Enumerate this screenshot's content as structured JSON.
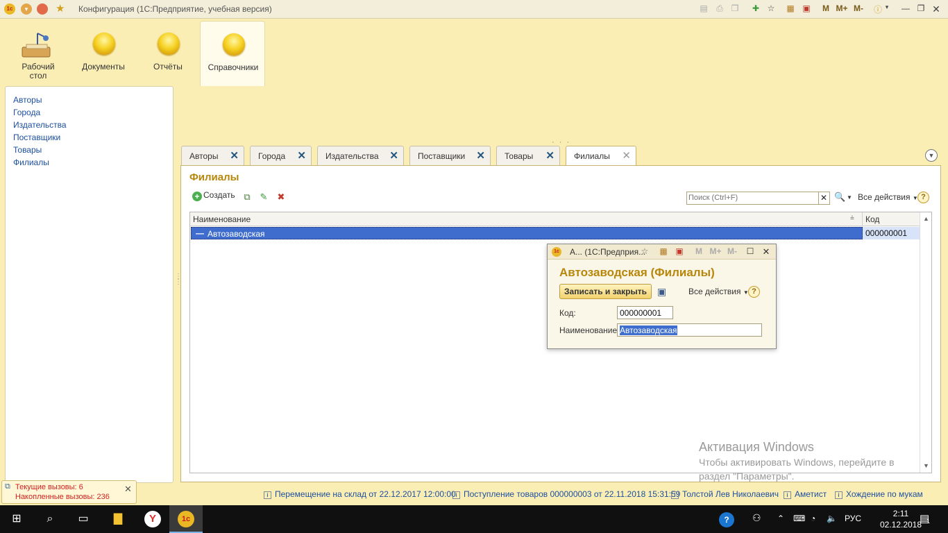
{
  "window": {
    "title": "Конфигурация  (1С:Предприятие, учебная версия)"
  },
  "titlebar_icons": [
    "save-icon",
    "print-icon",
    "copy-icon",
    "add-favorite-icon",
    "favorites-icon",
    "calculator-icon",
    "calendar-icon",
    "M",
    "M+",
    "M-",
    "info-icon",
    "minimize-icon",
    "restore-icon",
    "close-icon"
  ],
  "sections": [
    {
      "name": "desktop",
      "label": "Рабочий стол"
    },
    {
      "name": "documents",
      "label": "Документы"
    },
    {
      "name": "reports",
      "label": "Отчёты"
    },
    {
      "name": "catalogs",
      "label": "Справочники",
      "active": true
    }
  ],
  "nav": [
    "Авторы",
    "Города",
    "Издательства",
    "Поставщики",
    "Товары",
    "Филиалы"
  ],
  "tabs": [
    "Авторы",
    "Города",
    "Издательства",
    "Поставщики",
    "Товары",
    "Филиалы"
  ],
  "list": {
    "title": "Филиалы",
    "create_label": "Создать",
    "search_placeholder": "Поиск (Ctrl+F)",
    "all_actions": "Все действия",
    "columns": {
      "name": "Наименование",
      "code": "Код"
    },
    "rows": [
      {
        "name": "Автозаводская",
        "code": "000000001"
      }
    ]
  },
  "dialog": {
    "title": "А...  (1С:Предприя...",
    "heading": "Автозаводская (Филиалы)",
    "save_close": "Записать и закрыть",
    "all_actions": "Все действия",
    "code_label": "Код:",
    "code_value": "000000001",
    "name_label": "Наименование:",
    "name_value": "Автозаводская",
    "title_icons": [
      "M",
      "M+",
      "M-"
    ]
  },
  "watermark": {
    "title": "Активация Windows",
    "line1": "Чтобы активировать Windows, перейдите в",
    "line2": "раздел \"Параметры\"."
  },
  "status_links": [
    "Перемещение на склад  от 22.12.2017 12:00:00",
    "Поступление товаров 000000003 от 22.11.2018 15:31:59",
    "Толстой Лев Николаевич",
    "Аметист",
    "Хождение по мукам"
  ],
  "calls": {
    "current": "Текущие вызовы: 6",
    "accumulated": "Накопленные вызовы: 236"
  },
  "taskbar": {
    "language": "РУС",
    "time": "2:11",
    "date": "02.12.2018",
    "notifications": "1"
  },
  "colors": {
    "accent": "#b8860b",
    "link": "#1c4fa0",
    "selection": "#3f6dcd",
    "background": "#fbeeb4"
  }
}
